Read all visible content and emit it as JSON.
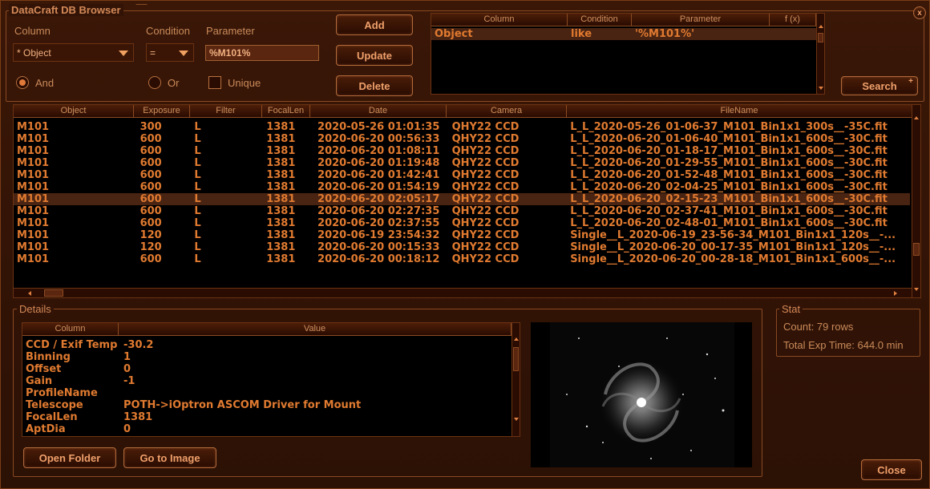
{
  "window": {
    "title": "DataCraft DB Browser",
    "close_glyph": "x"
  },
  "filter": {
    "column_label": "Column",
    "condition_label": "Condition",
    "parameter_label": "Parameter",
    "column_value": "* Object",
    "condition_value": "=",
    "parameter_value": "%M101%",
    "and_label": "And",
    "or_label": "Or",
    "unique_label": "Unique",
    "and_selected": true,
    "or_selected": false,
    "unique_checked": false
  },
  "buttons": {
    "add": "Add",
    "update": "Update",
    "delete": "Delete",
    "search": "Search",
    "search_plus": "+",
    "open_folder": "Open Folder",
    "go_to_image": "Go to Image",
    "close": "Close"
  },
  "conditions_grid": {
    "headers": [
      "Column",
      "Condition",
      "Parameter",
      "f (x)"
    ],
    "rows": [
      [
        "Object",
        "like",
        "'%M101%'",
        ""
      ]
    ]
  },
  "results_grid": {
    "headers": [
      "Object",
      "Exposure",
      "Filter",
      "FocalLen",
      "Date",
      "Camera",
      "FileName"
    ],
    "selected_index": 6,
    "rows": [
      [
        "M101",
        "300",
        "L",
        "1381",
        "2020-05-26 01:01:35",
        "QHY22 CCD",
        "L_L_2020-05-26_01-06-37_M101_Bin1x1_300s__-35C.fit"
      ],
      [
        "M101",
        "600",
        "L",
        "1381",
        "2020-06-20 00:56:33",
        "QHY22 CCD",
        "L_L_2020-06-20_01-06-40_M101_Bin1x1_600s__-30C.fit"
      ],
      [
        "M101",
        "600",
        "L",
        "1381",
        "2020-06-20 01:08:11",
        "QHY22 CCD",
        "L_L_2020-06-20_01-18-17_M101_Bin1x1_600s__-30C.fit"
      ],
      [
        "M101",
        "600",
        "L",
        "1381",
        "2020-06-20 01:19:48",
        "QHY22 CCD",
        "L_L_2020-06-20_01-29-55_M101_Bin1x1_600s__-30C.fit"
      ],
      [
        "M101",
        "600",
        "L",
        "1381",
        "2020-06-20 01:42:41",
        "QHY22 CCD",
        "L_L_2020-06-20_01-52-48_M101_Bin1x1_600s__-30C.fit"
      ],
      [
        "M101",
        "600",
        "L",
        "1381",
        "2020-06-20 01:54:19",
        "QHY22 CCD",
        "L_L_2020-06-20_02-04-25_M101_Bin1x1_600s__-30C.fit"
      ],
      [
        "M101",
        "600",
        "L",
        "1381",
        "2020-06-20 02:05:17",
        "QHY22 CCD",
        "L_L_2020-06-20_02-15-23_M101_Bin1x1_600s__-30C.fit"
      ],
      [
        "M101",
        "600",
        "L",
        "1381",
        "2020-06-20 02:27:35",
        "QHY22 CCD",
        "L_L_2020-06-20_02-37-41_M101_Bin1x1_600s__-30C.fit"
      ],
      [
        "M101",
        "600",
        "L",
        "1381",
        "2020-06-20 02:37:55",
        "QHY22 CCD",
        "L_L_2020-06-20_02-48-01_M101_Bin1x1_600s__-30C.fit"
      ],
      [
        "M101",
        "120",
        "L",
        "1381",
        "2020-06-19 23:54:32",
        "QHY22 CCD",
        "Single__L_2020-06-19_23-56-34_M101_Bin1x1_120s__-..."
      ],
      [
        "M101",
        "120",
        "L",
        "1381",
        "2020-06-20 00:15:33",
        "QHY22 CCD",
        "Single__L_2020-06-20_00-17-35_M101_Bin1x1_120s__-..."
      ],
      [
        "M101",
        "600",
        "L",
        "1381",
        "2020-06-20 00:18:12",
        "QHY22 CCD",
        "Single__L_2020-06-20_00-28-18_M101_Bin1x1_600s__-..."
      ]
    ]
  },
  "details": {
    "title": "Details",
    "headers": [
      "Column",
      "Value"
    ],
    "rows": [
      [
        "CCD / Exif Temp",
        "-30.2"
      ],
      [
        "Binning",
        "1"
      ],
      [
        "Offset",
        "0"
      ],
      [
        "Gain",
        "-1"
      ],
      [
        "ProfileName",
        ""
      ],
      [
        "Telescope",
        "POTH->iOptron ASCOM Driver for Mount"
      ],
      [
        "FocalLen",
        "1381"
      ],
      [
        "AptDia",
        "0"
      ]
    ]
  },
  "stat": {
    "title": "Stat",
    "count": "Count: 79  rows",
    "total_exp": "Total Exp Time: 644.0 min"
  },
  "colors": {
    "accent": "#e07a30",
    "panel": "#321306",
    "border": "#8a4a22"
  }
}
